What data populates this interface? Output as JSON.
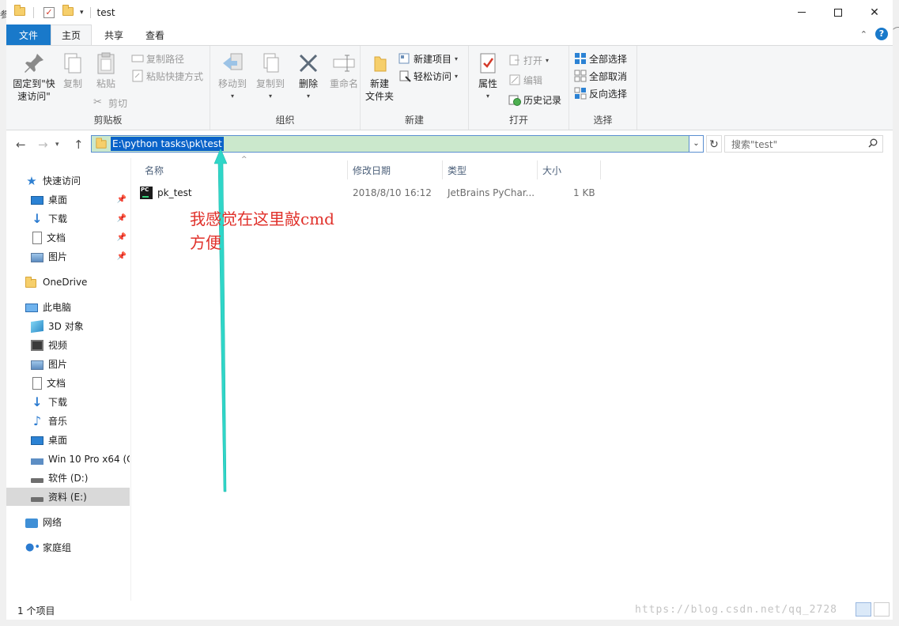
{
  "window": {
    "title": "test",
    "controls": {
      "minimize": "—",
      "maximize": "☐",
      "close": "✕"
    }
  },
  "side_cut_char": "参",
  "ribbon_tabs": [
    "文件",
    "主页",
    "共享",
    "查看"
  ],
  "ribbon": {
    "clipboard": {
      "label": "剪贴板",
      "pin_quick": "固定到\"快\n速访问\"",
      "copy": "复制",
      "paste": "粘贴",
      "copy_path": "复制路径",
      "paste_shortcut": "粘贴快捷方式",
      "cut": "剪切"
    },
    "organize": {
      "label": "组织",
      "move_to": "移动到",
      "copy_to": "复制到",
      "delete": "删除",
      "rename": "重命名"
    },
    "new": {
      "label": "新建",
      "new_folder": "新建\n文件夹",
      "new_item": "新建项目",
      "easy_access": "轻松访问"
    },
    "open": {
      "label": "打开",
      "properties": "属性",
      "open": "打开",
      "edit": "编辑",
      "history": "历史记录"
    },
    "select": {
      "label": "选择",
      "select_all": "全部选择",
      "select_none": "全部取消",
      "invert": "反向选择"
    }
  },
  "navigation": {
    "address": "E:\\python tasks\\pk\\test",
    "search_placeholder": "搜索\"test\""
  },
  "nav_pane": {
    "items": [
      {
        "label": "快速访问",
        "icon": "star-icon"
      },
      {
        "label": "桌面",
        "icon": "desktop-icon",
        "pinned": true
      },
      {
        "label": "下载",
        "icon": "download-icon",
        "pinned": true
      },
      {
        "label": "文档",
        "icon": "document-icon",
        "pinned": true
      },
      {
        "label": "图片",
        "icon": "picture-icon",
        "pinned": true
      },
      {
        "label": "OneDrive",
        "icon": "folder-icon"
      },
      {
        "label": "此电脑",
        "icon": "computer-icon"
      },
      {
        "label": "3D 对象",
        "icon": "3d-objects-icon"
      },
      {
        "label": "视频",
        "icon": "video-icon"
      },
      {
        "label": "图片",
        "icon": "picture-icon"
      },
      {
        "label": "文档",
        "icon": "document-icon"
      },
      {
        "label": "下载",
        "icon": "download-icon"
      },
      {
        "label": "音乐",
        "icon": "music-icon"
      },
      {
        "label": "桌面",
        "icon": "desktop-icon"
      },
      {
        "label": "Win 10 Pro x64 (C",
        "icon": "windows-drive-icon"
      },
      {
        "label": "软件 (D:)",
        "icon": "drive-icon"
      },
      {
        "label": "资料 (E:)",
        "icon": "drive-icon",
        "selected": true
      },
      {
        "label": "网络",
        "icon": "network-icon"
      },
      {
        "label": "家庭组",
        "icon": "homegroup-icon"
      }
    ]
  },
  "file_list": {
    "columns": [
      "名称",
      "修改日期",
      "类型",
      "大小"
    ],
    "rows": [
      {
        "name": "pk_test",
        "modified": "2018/8/10 16:12",
        "type": "JetBrains PyChar...",
        "size": "1 KB",
        "icon": "pycharm-file-icon"
      }
    ]
  },
  "annotation": {
    "line1": "我感觉在这里敲cmd",
    "line2": "方便",
    "color": "#e0302a",
    "arrow_color": "#2fd6c8"
  },
  "status": {
    "item_count": "1 个项目",
    "watermark": "https://blog.csdn.net/qq_2728"
  },
  "colors": {
    "file_tab": "#1979ca",
    "address_bg": "#cbe8cc",
    "selection": "#0a63c9"
  }
}
